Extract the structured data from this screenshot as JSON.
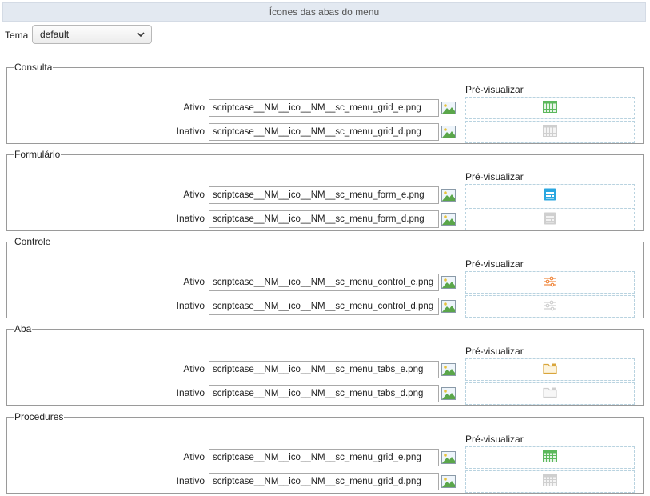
{
  "header": {
    "title": "Ícones das abas do menu"
  },
  "theme": {
    "label": "Tema",
    "selected": "default"
  },
  "labels": {
    "active": "Ativo",
    "inactive": "Inativo",
    "preview": "Pré-visualizar"
  },
  "groups": [
    {
      "title": "Consulta",
      "icon": "grid-table-icon",
      "color_active": "#5cb85c",
      "active_file": "scriptcase__NM__ico__NM__sc_menu_grid_e.png",
      "inactive_file": "scriptcase__NM__ico__NM__sc_menu_grid_d.png"
    },
    {
      "title": "Formulário",
      "icon": "form-icon",
      "color_active": "#2aa7e0",
      "active_file": "scriptcase__NM__ico__NM__sc_menu_form_e.png",
      "inactive_file": "scriptcase__NM__ico__NM__sc_menu_form_d.png"
    },
    {
      "title": "Controle",
      "icon": "sliders-icon",
      "color_active": "#f0883e",
      "active_file": "scriptcase__NM__ico__NM__sc_menu_control_e.png",
      "inactive_file": "scriptcase__NM__ico__NM__sc_menu_control_d.png"
    },
    {
      "title": "Aba",
      "icon": "tab-folder-icon",
      "color_active": "#d9a53a",
      "active_file": "scriptcase__NM__ico__NM__sc_menu_tabs_e.png",
      "inactive_file": "scriptcase__NM__ico__NM__sc_menu_tabs_d.png"
    },
    {
      "title": "Procedures",
      "icon": "grid-table-icon",
      "color_active": "#5cb85c",
      "active_file": "scriptcase__NM__ico__NM__sc_menu_grid_e.png",
      "inactive_file": "scriptcase__NM__ico__NM__sc_menu_grid_d.png"
    }
  ]
}
